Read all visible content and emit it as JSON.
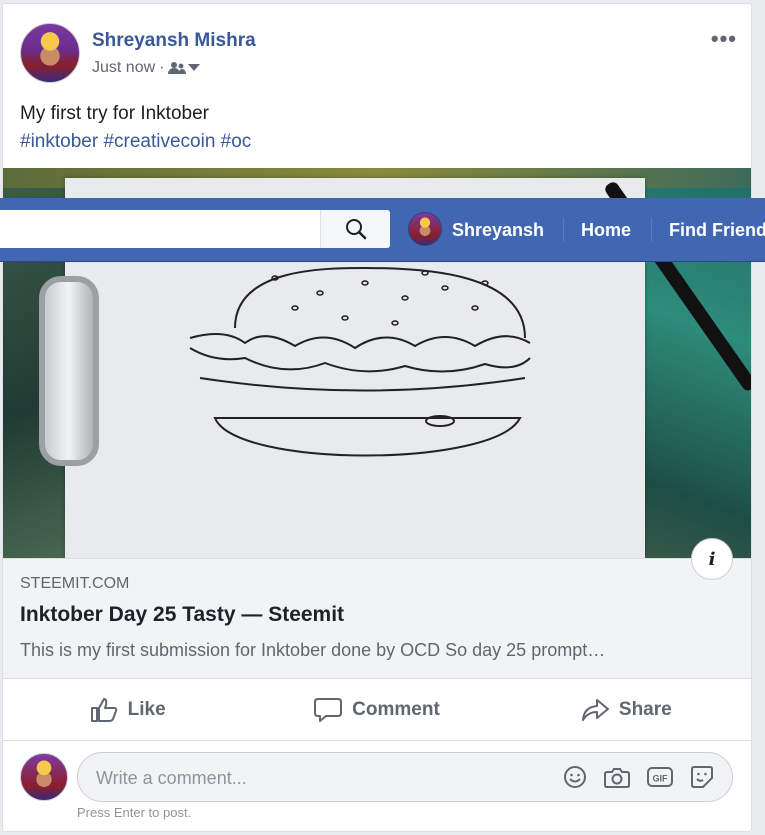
{
  "post": {
    "author": "Shreyansh Mishra",
    "timestamp": "Just now",
    "audience_icon": "friends-icon",
    "text": "My first try for Inktober",
    "hashtags": "#inktober #creativecoin #oc"
  },
  "fbbar": {
    "user_name": "Shreyansh",
    "nav_home": "Home",
    "nav_find_friends": "Find Friends"
  },
  "link_preview": {
    "domain": "STEEMIT.COM",
    "title": "Inktober Day 25 Tasty — Steemit",
    "description": "This is my first submission for Inktober done by OCD So day 25 prompt…"
  },
  "actions": {
    "like": "Like",
    "comment": "Comment",
    "share": "Share"
  },
  "comment_box": {
    "placeholder": "Write a comment...",
    "hint": "Press Enter to post."
  },
  "colors": {
    "brand_blue": "#4267b2",
    "link_blue": "#385898"
  }
}
